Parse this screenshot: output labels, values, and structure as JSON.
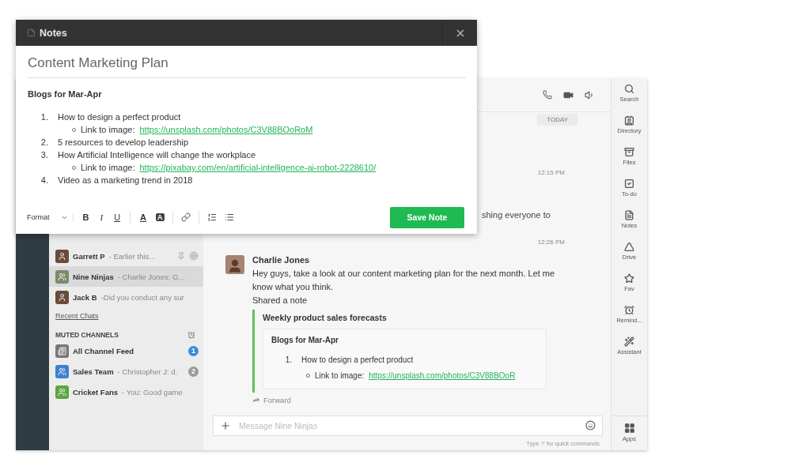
{
  "notes": {
    "title": "Notes",
    "doc_title": "Content Marketing Plan",
    "heading": "Blogs for Mar-Apr",
    "items": [
      {
        "number": "1.",
        "text": "How to design a perfect product",
        "links": [
          {
            "label": "Link to image:",
            "url": "https://unsplash.com/photos/C3V88BOoRoM"
          }
        ]
      },
      {
        "number": "2.",
        "text": "5 resources to develop leadership"
      },
      {
        "number": "3.",
        "text": "How Artificial Intelligence will change the workplace",
        "links": [
          {
            "label": "Link to image:",
            "url": "https://pixabay.com/en/artificial-intelligence-ai-robot-2228610/"
          }
        ]
      },
      {
        "number": "4.",
        "text": "Video as a marketing trend in 2018"
      }
    ],
    "toolbar": {
      "format": "Format",
      "bold": "B",
      "italic": "I",
      "underline": "U",
      "text_color": "A",
      "highlight": "A"
    },
    "save": "Save Note"
  },
  "sidebar": {
    "chats": [
      {
        "name": "Garrett P",
        "preview": "- Earlier this...",
        "selected": false,
        "pinned": true
      },
      {
        "name": "Nine Ninjas",
        "preview": "- Charlie Jones: G...",
        "selected": true,
        "pinned": false
      },
      {
        "name": "Jack B",
        "preview": "-Did you conduct any sur",
        "selected": false,
        "pinned": false
      }
    ],
    "recent_link": "Recent Chats",
    "muted_title": "MUTED CHANNELS",
    "muted": [
      {
        "name": "All Channel Feed",
        "badge": "1",
        "color": "#3a8be0"
      },
      {
        "name": "Sales Team",
        "preview": "- Christopher J: d.",
        "badge": "2",
        "color": "#9a9a9a"
      },
      {
        "name": "Cricket Fans",
        "preview": "- You: Good game"
      }
    ]
  },
  "chat": {
    "date": "TODAY",
    "time_1": "12:15 PM",
    "fragment": "shing everyone to",
    "time_2": "12:26 PM",
    "message": {
      "author": "Charlie Jones",
      "text": "Hey guys, take a look at our content marketing plan for the next month. Let me know what you think.",
      "shared_label": "Shared a note",
      "note": {
        "title": "Weekly product sales forecasts",
        "heading": "Blogs for Mar-Apr",
        "number": "1.",
        "text": "How to design a perfect product",
        "link_label": "Link to image:",
        "url": "https://unsplash.com/photos/C3V88BOoR"
      },
      "forward": "Forward"
    },
    "composer": {
      "placeholder": "Message Nine Ninjas"
    },
    "hint": "Type '/' for quick commands"
  },
  "rail": {
    "items": [
      {
        "label": "Search"
      },
      {
        "label": "Directory"
      },
      {
        "label": "Files"
      },
      {
        "label": "To-do"
      },
      {
        "label": "Notes"
      },
      {
        "label": "Drive"
      },
      {
        "label": "Fav"
      },
      {
        "label": "Remind..."
      },
      {
        "label": "Assistant"
      }
    ],
    "apps": "Apps"
  }
}
